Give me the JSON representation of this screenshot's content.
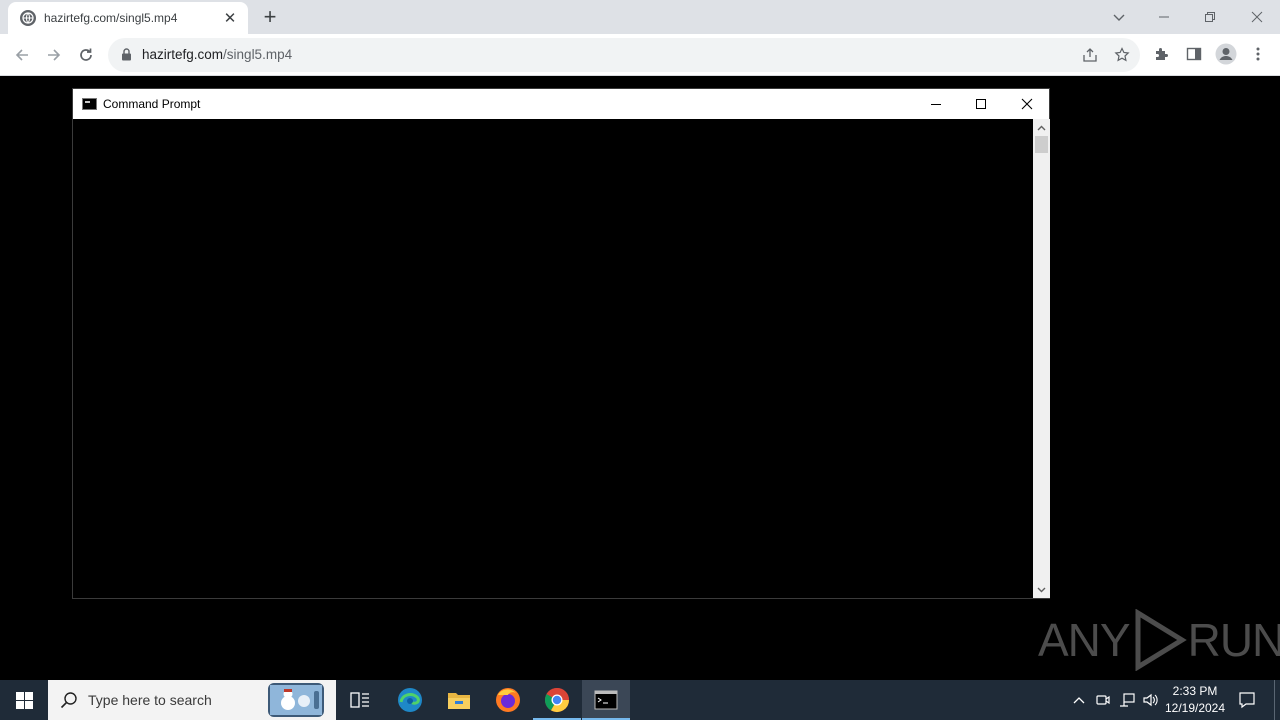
{
  "browser": {
    "tab": {
      "title": "hazirtefg.com/singl5.mp4",
      "close_glyph": "✕"
    },
    "new_tab_glyph": "+",
    "address": {
      "domain": "hazirtefg.com",
      "path": "/singl5.mp4"
    }
  },
  "cmd_window": {
    "title": "Command Prompt"
  },
  "watermark": {
    "text_left": "ANY",
    "text_right": "RUN"
  },
  "taskbar": {
    "search_placeholder": "Type here to search",
    "clock_time": "2:33 PM",
    "clock_date": "12/19/2024",
    "apps": [
      "task-view",
      "edge",
      "file-explorer",
      "firefox",
      "chrome",
      "command-prompt"
    ]
  },
  "colors": {
    "chrome_tabbar": "#dee1e6",
    "taskbar": "#1f2b38",
    "cmd_background": "#000000"
  }
}
